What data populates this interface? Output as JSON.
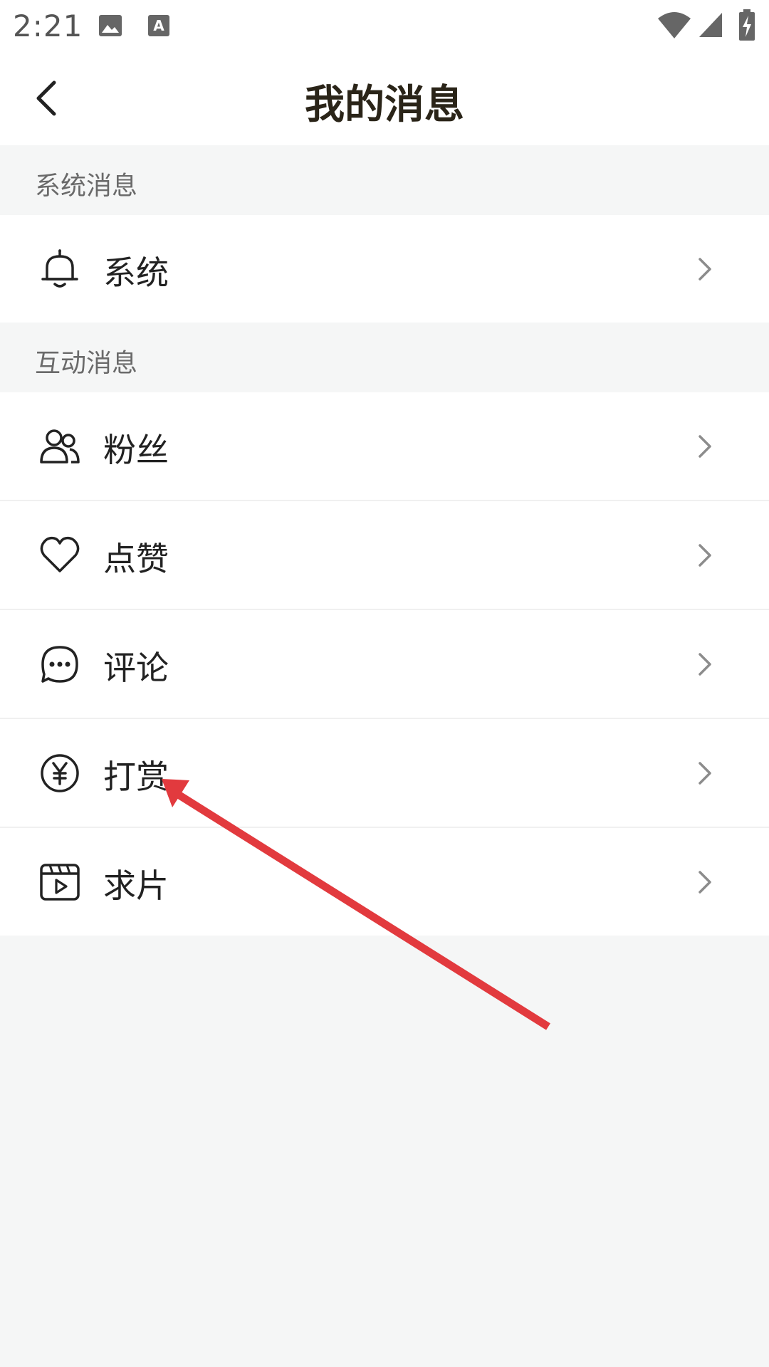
{
  "status_bar": {
    "time": "2:21",
    "icons": [
      "image-icon",
      "text-a-icon",
      "wifi-icon",
      "signal-icon",
      "battery-charging-icon"
    ]
  },
  "header": {
    "title": "我的消息",
    "back_icon": "back-arrow-icon"
  },
  "sections": [
    {
      "label": "系统消息",
      "items": [
        {
          "label": "系统",
          "icon": "bell-icon"
        }
      ]
    },
    {
      "label": "互动消息",
      "items": [
        {
          "label": "粉丝",
          "icon": "fans-icon"
        },
        {
          "label": "点赞",
          "icon": "heart-icon"
        },
        {
          "label": "评论",
          "icon": "comment-icon"
        },
        {
          "label": "打赏",
          "icon": "yuan-icon"
        },
        {
          "label": "求片",
          "icon": "video-request-icon"
        }
      ]
    }
  ],
  "colors": {
    "background": "#f5f6f6",
    "surface": "#ffffff",
    "title": "#2a2418",
    "annotation_arrow": "#e23a3e"
  },
  "annotation": {
    "type": "arrow",
    "points_to": "打赏"
  }
}
